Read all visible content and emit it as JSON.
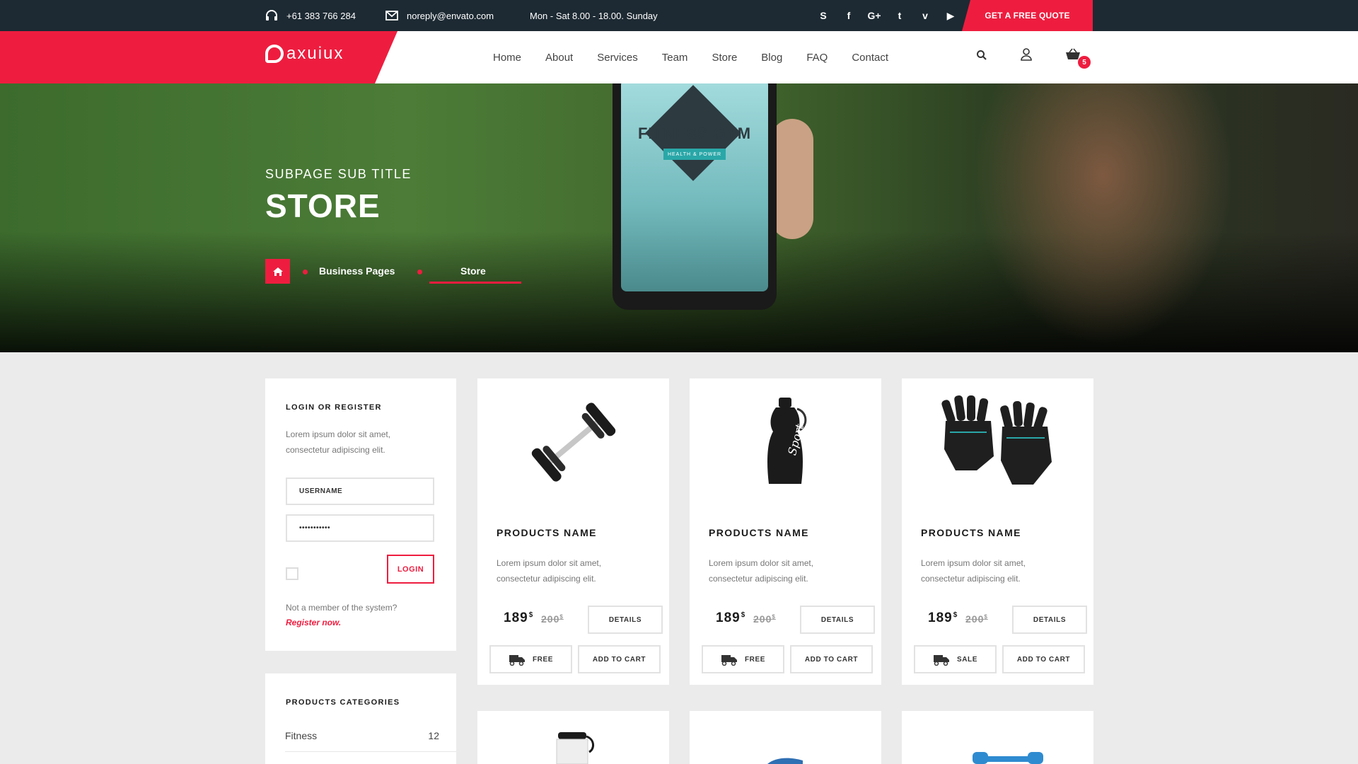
{
  "topbar": {
    "phone": "+61 383 766 284",
    "email": "noreply@envato.com",
    "hours": "Mon - Sat 8.00 - 18.00. Sunday",
    "social": [
      {
        "icon": "skype-icon",
        "glyph": "S"
      },
      {
        "icon": "facebook-icon",
        "glyph": "f"
      },
      {
        "icon": "google-plus-icon",
        "glyph": "G+"
      },
      {
        "icon": "twitter-icon",
        "glyph": "t"
      },
      {
        "icon": "vimeo-icon",
        "glyph": "v"
      },
      {
        "icon": "youtube-icon",
        "glyph": "▶"
      }
    ],
    "quote_button": "GET A FREE QUOTE"
  },
  "header": {
    "logo": "axuiux",
    "nav": [
      "Home",
      "About",
      "Services",
      "Team",
      "Store",
      "Blog",
      "FAQ",
      "Contact"
    ],
    "cart_count": "5"
  },
  "hero": {
    "subtitle": "SUBPAGE SUB TITLE",
    "title": "STORE",
    "phone_logo_text": "FITNESS GYM",
    "phone_logo_sub": "HEALTH & POWER",
    "breadcrumb": [
      "Business Pages",
      "Store"
    ]
  },
  "login": {
    "heading": "LOGIN OR REGISTER",
    "text": "Lorem ipsum dolor sit amet, consectetur adipiscing elit.",
    "username_placeholder": "USERNAME",
    "password_value": "•••••••••••",
    "login_button": "LOGIN",
    "member_text": "Not a member of the system?",
    "register_link": "Register now."
  },
  "categories": {
    "heading": "PRODUCTS CATEGORIES",
    "items": [
      {
        "name": "Fitness",
        "count": "12"
      }
    ]
  },
  "products": [
    {
      "name": "PRODUCTS NAME",
      "desc": "Lorem ipsum dolor sit amet, consectetur adipiscing elit.",
      "price": "189",
      "old_price": "200",
      "currency": "$",
      "details": "DETAILS",
      "shipping": "FREE",
      "add_to_cart": "ADD TO CART",
      "image": "dumbbell"
    },
    {
      "name": "PRODUCTS NAME",
      "desc": "Lorem ipsum dolor sit amet, consectetur adipiscing elit.",
      "price": "189",
      "old_price": "200",
      "currency": "$",
      "details": "DETAILS",
      "shipping": "FREE",
      "add_to_cart": "ADD TO CART",
      "image": "water-bottle",
      "image_text": "Sport"
    },
    {
      "name": "PRODUCTS NAME",
      "desc": "Lorem ipsum dolor sit amet, consectetur adipiscing elit.",
      "price": "189",
      "old_price": "200",
      "currency": "$",
      "details": "DETAILS",
      "shipping": "SALE",
      "add_to_cart": "ADD TO CART",
      "image": "fitness-gloves"
    }
  ],
  "colors": {
    "accent": "#ee1d3f",
    "topbar": "#1d2a33",
    "background": "#ebebeb"
  }
}
